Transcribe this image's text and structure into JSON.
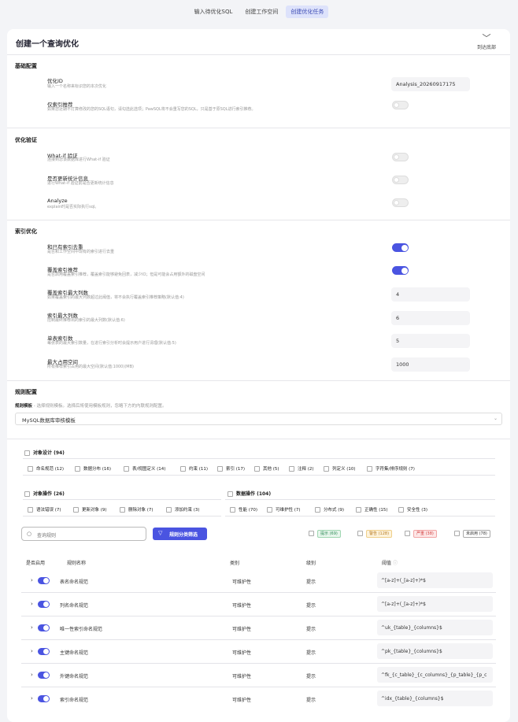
{
  "tabs": [
    {
      "label": "输入待优化SQL"
    },
    {
      "label": "创建工作空间"
    },
    {
      "label": "创建优化任务"
    }
  ],
  "page": {
    "title": "创建一个查询优化",
    "scroll_bottom_label": "到达底部"
  },
  "basic": {
    "title": "基础配置",
    "optimize_id": {
      "label": "优化ID",
      "desc": "输入一个名称来标识您的本次优化",
      "value": "Analysis_20260917175"
    },
    "index_only": {
      "label": "仅索引推荐",
      "desc": "如果您近期不打算修改的您的SQL语句，请勾选此选项；PawSQL将不会重写您的SQL，只是基于原SQL进行索引推荐。",
      "enabled": false
    }
  },
  "verify": {
    "title": "优化验证",
    "whatif": {
      "label": "What-if 验证",
      "desc": "连接到您该数据库进行What-if 验证",
      "enabled": false
    },
    "update_stats": {
      "label": "是否更新统计信息",
      "desc": "进行What-if 验证前是否更新统计信息",
      "enabled": false
    },
    "analyze": {
      "label": "Analyze",
      "desc": "explain时是否实际执行sql。",
      "enabled": false
    }
  },
  "index": {
    "title": "索引优化",
    "dedupe": {
      "label": "和已有索引去重",
      "desc": "是否和工作空间中现有的索引进行去重",
      "enabled": true
    },
    "covering": {
      "label": "覆盖索引推荐",
      "desc": "是否启用覆盖索引推荐，覆盖索引能够避免回表，减少IO；但是可能会占用额外的磁盘空间",
      "enabled": true
    },
    "max_cols_covering": {
      "label": "覆盖索引最大列数",
      "desc": "如果覆盖索引的最大列数超过此阈值，将不会执行覆盖索引推荐策略(默认值:4)",
      "value": "4"
    },
    "max_cols": {
      "label": "索引最大列数",
      "desc": "控制最终推荐出的索引的最大列数(默认值:6)",
      "value": "6"
    },
    "max_per_table": {
      "label": "单表索引数",
      "desc": "每张表的最大索引数量，在进行索引分析时会提示用户进行清理(默认值:5)",
      "value": "5"
    },
    "max_space": {
      "label": "最大占用空间",
      "desc": "所有推荐索引占用的最大空间(默认值:1000)(MB)",
      "value": "1000"
    }
  },
  "rules": {
    "title": "规则配置",
    "template_label": "规则模板",
    "template_desc": " - 选择规则模板。选择后将使用模板规则，忽略下方的内联规则配置。",
    "template_value": "MySQL数据库审核模板",
    "design": {
      "name": "对象设计 (94)",
      "items": [
        "命名规范 (12)",
        "数据分布 (16)",
        "表/视图定义 (14)",
        "约束 (11)",
        "索引 (17)",
        "其他 (5)",
        "注释 (2)",
        "列定义 (10)",
        "字符集/排序规则 (7)"
      ]
    },
    "ops": {
      "name": "对象操作 (26)",
      "items": [
        "语法错误 (7)",
        "更新对象 (9)",
        "删除对象 (7)",
        "添加约束 (3)"
      ]
    },
    "dataops": {
      "name": "数据操作 (104)",
      "items": [
        "性能 (70)",
        "可维护性 (7)",
        "分布式 (9)",
        "正确性 (15)",
        "安全性 (3)"
      ]
    },
    "search_placeholder": "查询规则",
    "filter_button": "规则分类筛选",
    "levels": [
      {
        "label": "提示 (69)",
        "color": "#2e8b57",
        "bg": "#e7f6ec"
      },
      {
        "label": "警告 (128)",
        "color": "#b7791f",
        "bg": "#fdf3dc"
      },
      {
        "label": "严重 (38)",
        "color": "#d23f3f",
        "bg": "#fde7e7"
      },
      {
        "label": "未启用 (78)",
        "color": "#333333",
        "bg": "#ffffff"
      }
    ],
    "columns": {
      "enabled": "是否启用",
      "name": "规则名称",
      "category": "类别",
      "level": "级别",
      "threshold": "阈值"
    },
    "table": [
      {
        "name": "表名命名规范",
        "category": "可维护性",
        "level": "提示",
        "threshold": "^[a-z]+(_[a-z]+)*$"
      },
      {
        "name": "列名命名规范",
        "category": "可维护性",
        "level": "提示",
        "threshold": "^[a-z]+(_[a-z]+)*$"
      },
      {
        "name": "唯一性索引命名规范",
        "category": "可维护性",
        "level": "提示",
        "threshold": "^uk_{table}_{columns}$"
      },
      {
        "name": "主键命名规范",
        "category": "可维护性",
        "level": "提示",
        "threshold": "^pk_{table}_{columns}$"
      },
      {
        "name": "外键命名规范",
        "category": "可维护性",
        "level": "提示",
        "threshold": "^fk_{c_table}_{c_columns}_{p_table}_{p_c"
      },
      {
        "name": "索引命名规范",
        "category": "可维护性",
        "level": "提示",
        "threshold": "^idx_{table}_{columns}$"
      }
    ]
  }
}
